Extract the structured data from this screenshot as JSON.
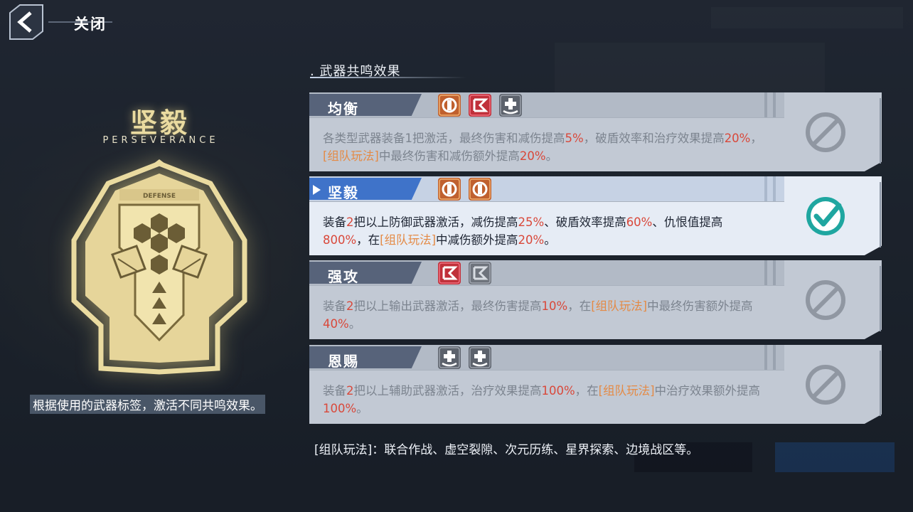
{
  "nav": {
    "close_label": "关闭"
  },
  "emblem": {
    "title": "坚毅",
    "subtitle": "PERSEVERANCE",
    "badge_text": "DEFENSE",
    "description": "根据使用的武器标签，激活不同共鸣效果。",
    "color": "#eadba0"
  },
  "section": {
    "title": "武器共鸣效果",
    "bullet": "."
  },
  "cards": [
    {
      "name": "均衡",
      "active": false,
      "icons": [
        "defense-weapon-icon",
        "attack-weapon-icon",
        "support-weapon-icon"
      ],
      "description_parts": [
        {
          "t": "各类型武器装备1把激活，最终伤害和减伤提高"
        },
        {
          "t": "5%",
          "c": "red"
        },
        {
          "t": "，破盾效率和治疗效果提高"
        },
        {
          "t": "20%",
          "c": "red"
        },
        {
          "t": "，"
        },
        {
          "t": "[组队玩法]",
          "c": "orange"
        },
        {
          "t": "中最终伤害和减伤额外提高"
        },
        {
          "t": "20%",
          "c": "red"
        },
        {
          "t": "。"
        }
      ],
      "status": "inactive"
    },
    {
      "name": "坚毅",
      "active": true,
      "icons": [
        "defense-weapon-icon",
        "defense-weapon-icon"
      ],
      "description_parts": [
        {
          "t": "装备"
        },
        {
          "t": "2",
          "c": "red"
        },
        {
          "t": "把以上防御武器激活，减伤提高"
        },
        {
          "t": "25%",
          "c": "red"
        },
        {
          "t": "、破盾效率提高"
        },
        {
          "t": "60%",
          "c": "red"
        },
        {
          "t": "、仇恨值提高"
        },
        {
          "t": "800%",
          "c": "red"
        },
        {
          "t": "，在"
        },
        {
          "t": "[组队玩法]",
          "c": "orange"
        },
        {
          "t": "中减伤额外提高"
        },
        {
          "t": "20%",
          "c": "red"
        },
        {
          "t": "。"
        }
      ],
      "status": "active"
    },
    {
      "name": "强攻",
      "active": false,
      "icons": [
        "attack-weapon-icon",
        "attack-weapon-icon-grey"
      ],
      "description_parts": [
        {
          "t": "装备"
        },
        {
          "t": "2",
          "c": "red"
        },
        {
          "t": "把以上输出武器激活，最终伤害提高"
        },
        {
          "t": "10%",
          "c": "red"
        },
        {
          "t": "，在"
        },
        {
          "t": "[组队玩法]",
          "c": "orange"
        },
        {
          "t": "中最终伤害额外提高"
        },
        {
          "t": "40%",
          "c": "red"
        },
        {
          "t": "。"
        }
      ],
      "status": "inactive"
    },
    {
      "name": "恩赐",
      "active": false,
      "icons": [
        "support-weapon-icon",
        "support-weapon-icon"
      ],
      "description_parts": [
        {
          "t": "装备"
        },
        {
          "t": "2",
          "c": "red"
        },
        {
          "t": "把以上辅助武器激活，治疗效果提高"
        },
        {
          "t": "100%",
          "c": "red"
        },
        {
          "t": "，在"
        },
        {
          "t": "[组队玩法]",
          "c": "orange"
        },
        {
          "t": "中治疗效果额外提高"
        },
        {
          "t": "100%",
          "c": "red"
        },
        {
          "t": "。"
        }
      ],
      "status": "inactive"
    }
  ],
  "footnote": "[组队玩法]：联合作战、虚空裂隙、次元历练、星界探索、边境战区等。",
  "colors": {
    "highlight_red": "#d9483a",
    "highlight_orange": "#e48a45",
    "active_tab": "#3f73c9",
    "check_teal": "#1fa6a0"
  }
}
